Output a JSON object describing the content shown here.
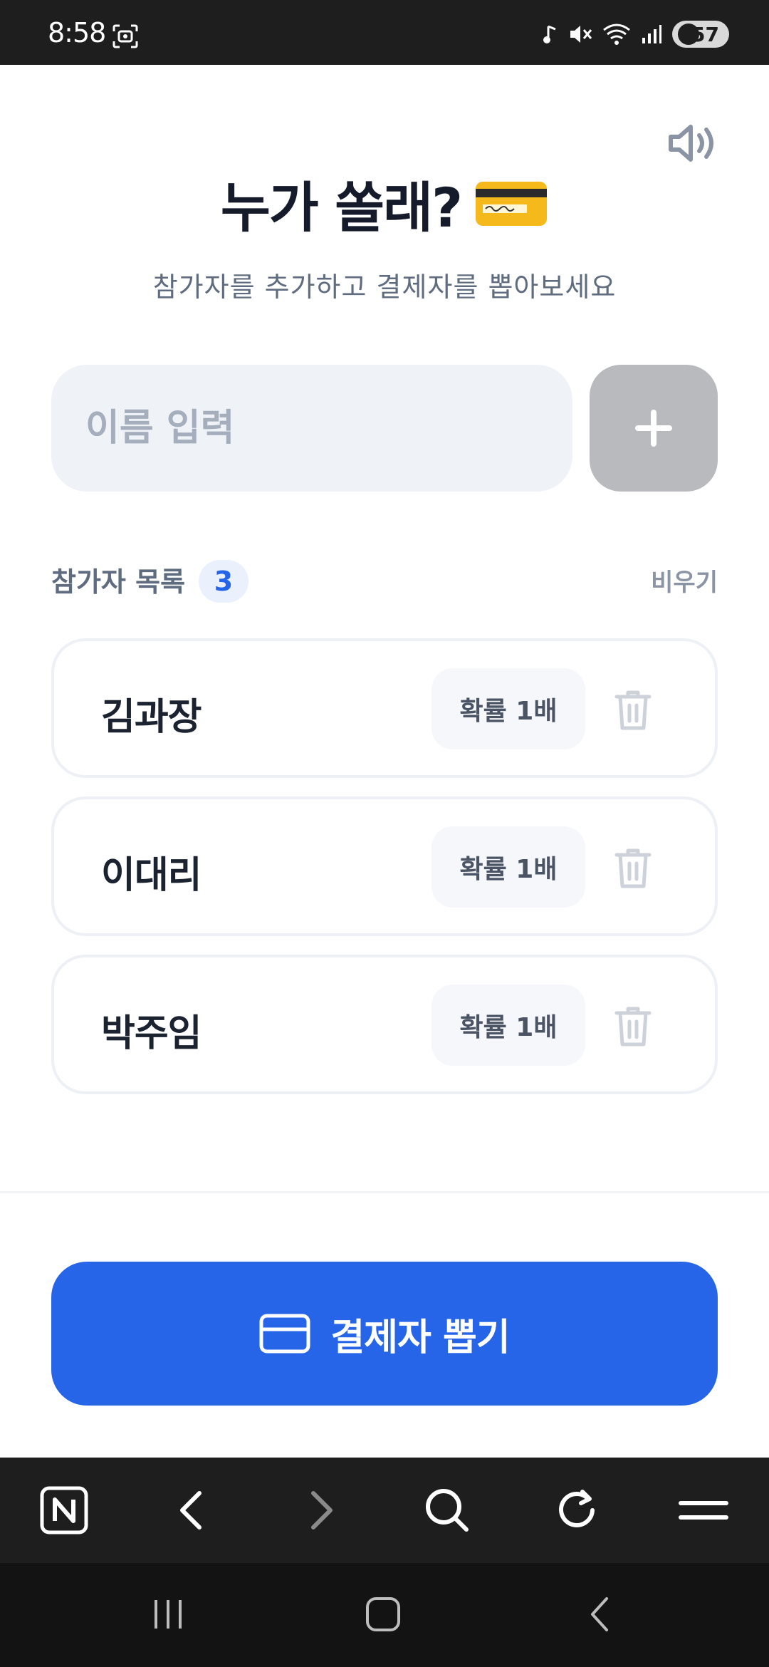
{
  "status_bar": {
    "time": "8:58",
    "battery": "57",
    "icons": [
      "screenshot-icon",
      "music-note-icon",
      "mute-icon",
      "wifi-icon",
      "signal-icon",
      "battery-icon"
    ]
  },
  "header": {
    "title": "누가 쏠래?",
    "subtitle": "참가자를 추가하고 결제자를 뽑아보세요",
    "sound_icon": "speaker-icon",
    "title_emoji": "credit-card-emoji"
  },
  "input": {
    "placeholder": "이름 입력",
    "add_icon": "plus-icon"
  },
  "participants_section": {
    "label": "참가자 목록",
    "count": "3",
    "clear_label": "비우기"
  },
  "participants": [
    {
      "name": "김과장",
      "probability": "확률 1배"
    },
    {
      "name": "이대리",
      "probability": "확률 1배"
    },
    {
      "name": "박주임",
      "probability": "확률 1배"
    }
  ],
  "draw_button": {
    "label": "결제자 뽑기",
    "icon": "credit-card-icon"
  },
  "browser_toolbar": {
    "items": [
      "naver-home-icon",
      "back-icon",
      "forward-icon",
      "search-icon",
      "refresh-icon",
      "menu-icon"
    ]
  },
  "system_nav": {
    "items": [
      "recent-apps-icon",
      "home-icon",
      "back-icon"
    ]
  },
  "colors": {
    "primary": "#2664e8",
    "title": "#151b2b",
    "muted": "#5f6c80",
    "add_button_disabled": "#b9babe"
  }
}
